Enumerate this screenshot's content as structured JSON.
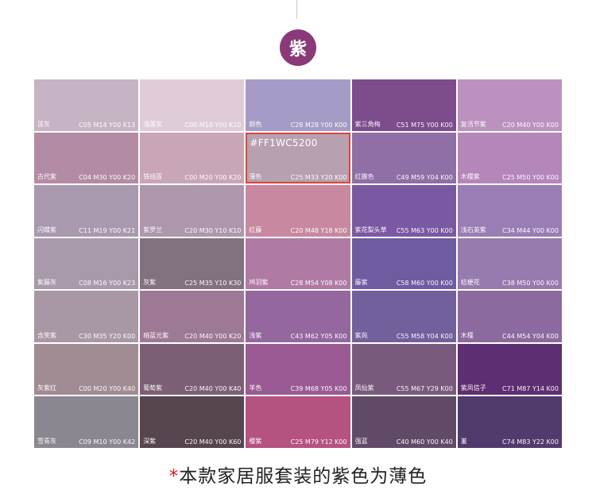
{
  "badge": {
    "label": "紫"
  },
  "swatches": [
    [
      {
        "name": "莲灰",
        "cmyk": "C05 M14 Y00 K13",
        "color": "#c6b3c4"
      },
      {
        "name": "浅莲灰",
        "cmyk": "C00 M10 Y00 K10",
        "color": "#e0ccd8"
      },
      {
        "name": "颜色",
        "cmyk": "C28 M28 Y00 K00",
        "color": "#a69bc6"
      },
      {
        "name": "紫三角梅",
        "cmyk": "C51 M75 Y00 K00",
        "color": "#7d4c8d"
      },
      {
        "name": "复活节紫",
        "cmyk": "C20 M40 Y00 K00",
        "color": "#bc91bf"
      }
    ],
    [
      {
        "name": "古代紫",
        "cmyk": "C04 M30 Y00 K20",
        "color": "#b48ba4"
      },
      {
        "name": "铁线莲",
        "cmyk": "C00 M20 Y00 K20",
        "color": "#c8a5b7"
      },
      {
        "name": "薄色",
        "cmyk": "C25 M33 Y20 K00",
        "color": "#b7a0b0",
        "hex": "#FF1WC5200",
        "highlight": true
      },
      {
        "name": "红膜色",
        "cmyk": "C49 M59 Y04 K00",
        "color": "#8f6fa6"
      },
      {
        "name": "木槿紫",
        "cmyk": "C25 M50 Y00 K00",
        "color": "#b486ba"
      }
    ],
    [
      {
        "name": "闪蝶紫",
        "cmyk": "C11 M19 Y00 K21",
        "color": "#a899ae"
      },
      {
        "name": "紫罗兰",
        "cmyk": "C20 M30 Y10 K10",
        "color": "#ae97ad"
      },
      {
        "name": "红藤",
        "cmyk": "C20 M48 Y18 K00",
        "color": "#c8889f"
      },
      {
        "name": "紫花梨头草",
        "cmyk": "C55 M63 Y00 K00",
        "color": "#7b58a2"
      },
      {
        "name": "浅石英紫",
        "cmyk": "C34 M44 Y00 K00",
        "color": "#9b7db6"
      }
    ],
    [
      {
        "name": "紫藤灰",
        "cmyk": "C08 M16 Y00 K23",
        "color": "#a99aab"
      },
      {
        "name": "灰紫",
        "cmyk": "C25 M35 Y10 K30",
        "color": "#82717f"
      },
      {
        "name": "鸠羽紫",
        "cmyk": "C28 M54 Y08 K00",
        "color": "#b07aa4"
      },
      {
        "name": "藤紫",
        "cmyk": "C58 M60 Y00 K00",
        "color": "#6e5ba0"
      },
      {
        "name": "桔梗花",
        "cmyk": "C38 M50 Y00 K00",
        "color": "#977aae"
      }
    ],
    [
      {
        "name": "含笑紫",
        "cmyk": "C30 M35 Y20 K00",
        "color": "#a898a6"
      },
      {
        "name": "暗蓝光紫",
        "cmyk": "C20 M40 Y00 K20",
        "color": "#9d7995"
      },
      {
        "name": "浅紫",
        "cmyk": "C43 M62 Y05 K00",
        "color": "#94679f"
      },
      {
        "name": "紫苑",
        "cmyk": "C55 M58 Y04 K00",
        "color": "#72609d"
      },
      {
        "name": "木槿",
        "cmyk": "C44 M54 Y04 K00",
        "color": "#8c6a9f"
      }
    ],
    [
      {
        "name": "灰紫红",
        "cmyk": "C00 M20 Y00 K40",
        "color": "#a08c92"
      },
      {
        "name": "葡萄紫",
        "cmyk": "C20 M40 Y00 K40",
        "color": "#7d5f75"
      },
      {
        "name": "羊色",
        "cmyk": "C39 M68 Y05 K00",
        "color": "#9a5b95"
      },
      {
        "name": "凤仙紫",
        "cmyk": "C55 M67 Y29 K00",
        "color": "#7a5a7c"
      },
      {
        "name": "紫凤信子",
        "cmyk": "C71 M87 Y14 K00",
        "color": "#5e2e72"
      }
    ],
    [
      {
        "name": "雪青灰",
        "cmyk": "C09 M10 Y00 K42",
        "color": "#8a8790"
      },
      {
        "name": "深紫",
        "cmyk": "C20 M40 Y00 K60",
        "color": "#56444f"
      },
      {
        "name": "樱紫",
        "cmyk": "C25 M79 Y12 K00",
        "color": "#b5527f"
      },
      {
        "name": "强蓝",
        "cmyk": "C40 M60 Y00 K40",
        "color": "#614a68"
      },
      {
        "name": "堇",
        "cmyk": "C74 M83 Y22 K00",
        "color": "#513b6c"
      }
    ]
  ],
  "caption": {
    "star": "*",
    "text": "本款家居服套装的紫色为薄色"
  }
}
